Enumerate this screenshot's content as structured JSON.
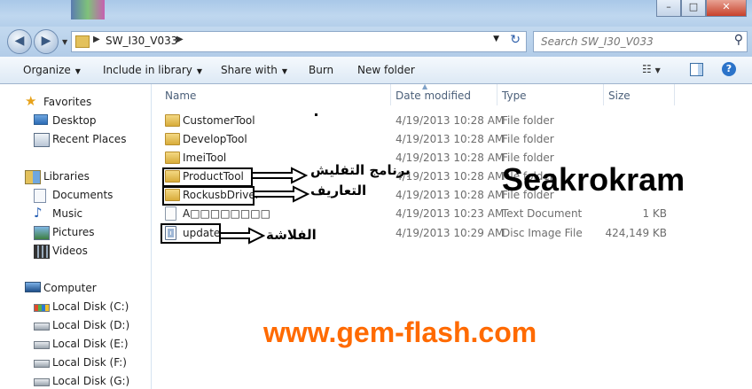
{
  "window": {
    "minimize": "–",
    "maximize": "□",
    "close": "✕"
  },
  "nav": {
    "back_icon": "back-arrow-icon",
    "forward_icon": "forward-arrow-icon",
    "address_path": "SW_I30_V033",
    "search_placeholder": "Search SW_I30_V033"
  },
  "toolbar": {
    "organize": "Organize",
    "include_in_library": "Include in library",
    "share_with": "Share with",
    "burn": "Burn",
    "new_folder": "New folder"
  },
  "sidebar": {
    "favorites": "Favorites",
    "desktop": "Desktop",
    "recent_places": "Recent Places",
    "libraries": "Libraries",
    "documents": "Documents",
    "music": "Music",
    "pictures": "Pictures",
    "videos": "Videos",
    "computer": "Computer",
    "drives": [
      "Local Disk (C:)",
      "Local Disk (D:)",
      "Local Disk (E:)",
      "Local Disk (F:)",
      "Local Disk (G:)"
    ]
  },
  "columns": {
    "name": "Name",
    "date_modified": "Date modified",
    "type": "Type",
    "size": "Size"
  },
  "files": [
    {
      "name": "CustomerTool",
      "date": "4/19/2013 10:28 AM",
      "type": "File folder",
      "size": ""
    },
    {
      "name": "DevelopTool",
      "date": "4/19/2013 10:28 AM",
      "type": "File folder",
      "size": ""
    },
    {
      "name": "ImeiTool",
      "date": "4/19/2013 10:28 AM",
      "type": "File folder",
      "size": ""
    },
    {
      "name": "ProductTool",
      "date": "4/19/2013 10:28 AM",
      "type": "File folder",
      "size": ""
    },
    {
      "name": "RockusbDriver",
      "date": "4/19/2013 10:28 AM",
      "type": "File folder",
      "size": ""
    },
    {
      "name": "A□□□□□□□□",
      "date": "4/19/2013 10:23 AM",
      "type": "Text Document",
      "size": "1 KB"
    },
    {
      "name": "update",
      "date": "4/19/2013 10:29 AM",
      "type": "Disc Image File",
      "size": "424,149 KB"
    }
  ],
  "annotations": {
    "product_tool": "برنامج التفليش",
    "rockusb_driver": "التعاريف",
    "update": "الفلاشة",
    "brand": "Seakrokram",
    "url": "www.gem-flash.com"
  }
}
